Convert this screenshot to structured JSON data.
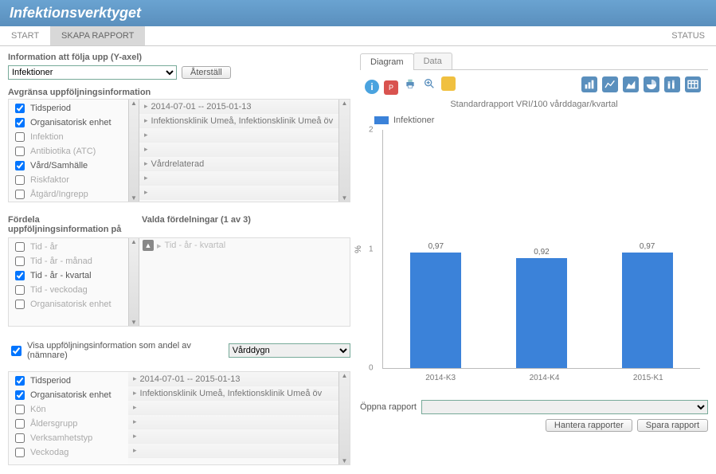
{
  "header": {
    "title": "Infektionsverktyget"
  },
  "tabs": {
    "start": "START",
    "skapa": "SKAPA RAPPORT",
    "status": "STATUS"
  },
  "yaxis": {
    "label": "Information att följa upp (Y-axel)",
    "value": "Infektioner",
    "reset": "Återställ"
  },
  "avgr": {
    "title": "Avgränsa uppföljningsinformation",
    "items": [
      {
        "label": "Tidsperiod",
        "checked": true,
        "value": "2014-07-01 -- 2015-01-13"
      },
      {
        "label": "Organisatorisk enhet",
        "checked": true,
        "value": "Infektionsklinik Umeå, Infektionsklinik Umeå öv"
      },
      {
        "label": "Infektion",
        "checked": false,
        "value": ""
      },
      {
        "label": "Antibiotika (ATC)",
        "checked": false,
        "value": ""
      },
      {
        "label": "Vård/Samhälle",
        "checked": true,
        "value": "Vårdrelaterad"
      },
      {
        "label": "Riskfaktor",
        "checked": false,
        "value": ""
      },
      {
        "label": "Åtgärd/Ingrepp",
        "checked": false,
        "value": ""
      }
    ]
  },
  "fordela": {
    "title": "Fördela uppföljningsinformation på",
    "valda_title": "Valda fördelningar (1 av 3)",
    "items": [
      {
        "label": "Tid - år",
        "checked": false
      },
      {
        "label": "Tid - år - månad",
        "checked": false
      },
      {
        "label": "Tid - år - kvartal",
        "checked": true
      },
      {
        "label": "Tid - veckodag",
        "checked": false
      },
      {
        "label": "Organisatorisk enhet",
        "checked": false
      }
    ],
    "valda_hint": "Tid - år - kvartal"
  },
  "andel": {
    "label": "Visa uppföljningsinformation som andel av (nämnare)",
    "checked": true,
    "value": "Vårddygn"
  },
  "filter2": {
    "items": [
      {
        "label": "Tidsperiod",
        "checked": true,
        "value": "2014-07-01 -- 2015-01-13"
      },
      {
        "label": "Organisatorisk enhet",
        "checked": true,
        "value": "Infektionsklinik Umeå, Infektionsklinik Umeå öv"
      },
      {
        "label": "Kön",
        "checked": false,
        "value": ""
      },
      {
        "label": "Åldersgrupp",
        "checked": false,
        "value": ""
      },
      {
        "label": "Verksamhetstyp",
        "checked": false,
        "value": ""
      },
      {
        "label": "Veckodag",
        "checked": false,
        "value": ""
      }
    ]
  },
  "right": {
    "tabs": {
      "diagram": "Diagram",
      "data": "Data"
    },
    "title": "Standardrapport VRI/100 vårddagar/kvartal",
    "legend": "Infektioner",
    "ylabel": "%",
    "openlabel": "Öppna rapport",
    "hantera": "Hantera rapporter",
    "spara": "Spara rapport"
  },
  "chart_data": {
    "type": "bar",
    "title": "Standardrapport VRI/100 vårddagar/kvartal",
    "xlabel": "",
    "ylabel": "%",
    "ylim": [
      0,
      2
    ],
    "categories": [
      "2014-K3",
      "2014-K4",
      "2015-K1"
    ],
    "series": [
      {
        "name": "Infektioner",
        "values": [
          0.97,
          0.92,
          0.97
        ]
      }
    ]
  }
}
